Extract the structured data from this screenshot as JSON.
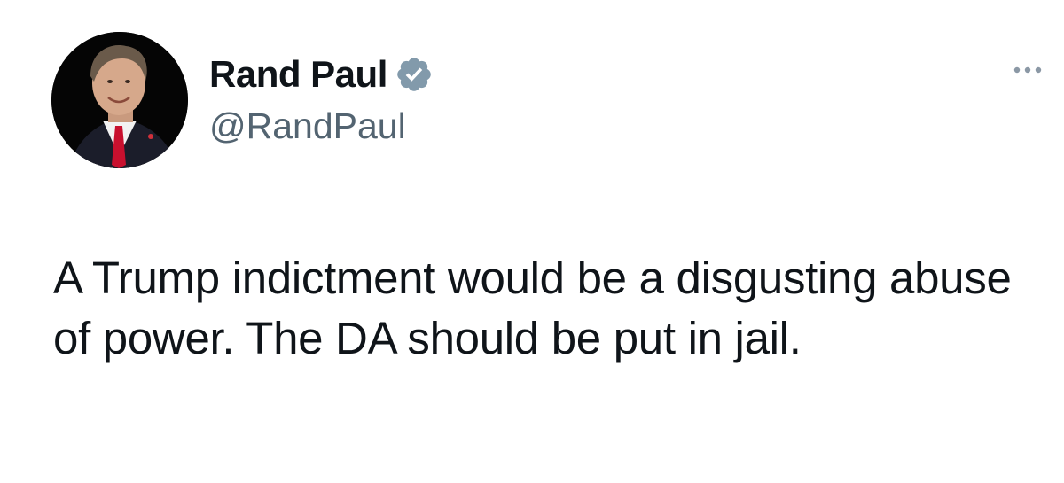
{
  "author": {
    "display_name": "Rand Paul",
    "handle": "@RandPaul",
    "verified": true
  },
  "icons": {
    "verified": "verified-badge-icon",
    "more": "more-options-icon"
  },
  "colors": {
    "badge": "#829aab",
    "handle": "#536471",
    "text": "#0f1419"
  },
  "tweet": {
    "text": "A Trump indictment would be a disgusting abuse of power. The DA should be put in jail."
  }
}
